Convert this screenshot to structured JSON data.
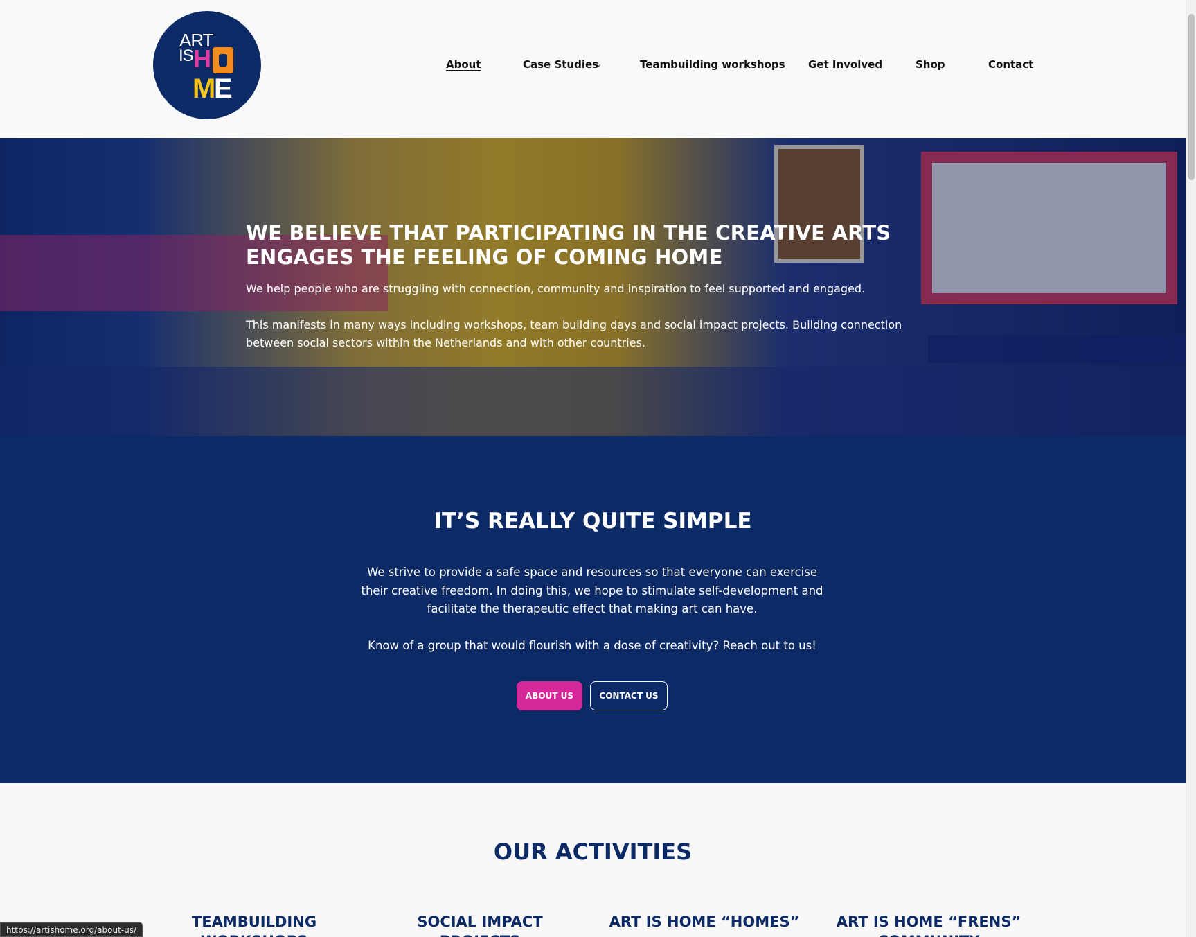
{
  "logo": {
    "line1": "ART",
    "line2": "IS",
    "h": "H",
    "m": "M",
    "e": "E",
    "colors": {
      "background": "#0c2a66",
      "pink": "#e33aa4",
      "orange": "#f28c1e",
      "yellow": "#f6c21c"
    }
  },
  "nav": {
    "items": [
      {
        "label": "About",
        "active": true
      },
      {
        "label": "Case Studies",
        "has_dropdown": true,
        "dropdown_icon": "chevron-down-icon"
      },
      {
        "label": "Teambuilding workshops"
      },
      {
        "label": "Get Involved"
      },
      {
        "label": "Shop"
      },
      {
        "label": "Contact"
      }
    ],
    "chevron": "⌄"
  },
  "hero": {
    "title": "We believe that participating in the creative arts engages the feeling of coming home",
    "paragraph1": "We help people who are struggling with connection, community and inspiration to feel supported and engaged.",
    "paragraph2": "This manifests in many ways including workshops, team building days and social impact projects. Building connection between social sectors within the Netherlands and with other countries."
  },
  "simple": {
    "title": "It’s really quite simple",
    "paragraph1": "We strive to provide a safe space and resources so that everyone can exercise their creative freedom. In doing this, we hope to stimulate self-development and facilitate the therapeutic effect that making art can have.",
    "paragraph2": "Know of a group that would flourish with a dose of creativity? Reach out to us!",
    "about_button": "About us",
    "contact_button": "Contact us"
  },
  "activities": {
    "title": "Our Activities",
    "columns": [
      "Teambuilding Workshops",
      "Social Impact Projects",
      "Art is Home “Homes”",
      "Art is Home “Frens” Community"
    ]
  },
  "status_url": "https://artishome.org/about-us/",
  "colors": {
    "navy": "#0c2a66",
    "magenta": "#d4279a"
  }
}
